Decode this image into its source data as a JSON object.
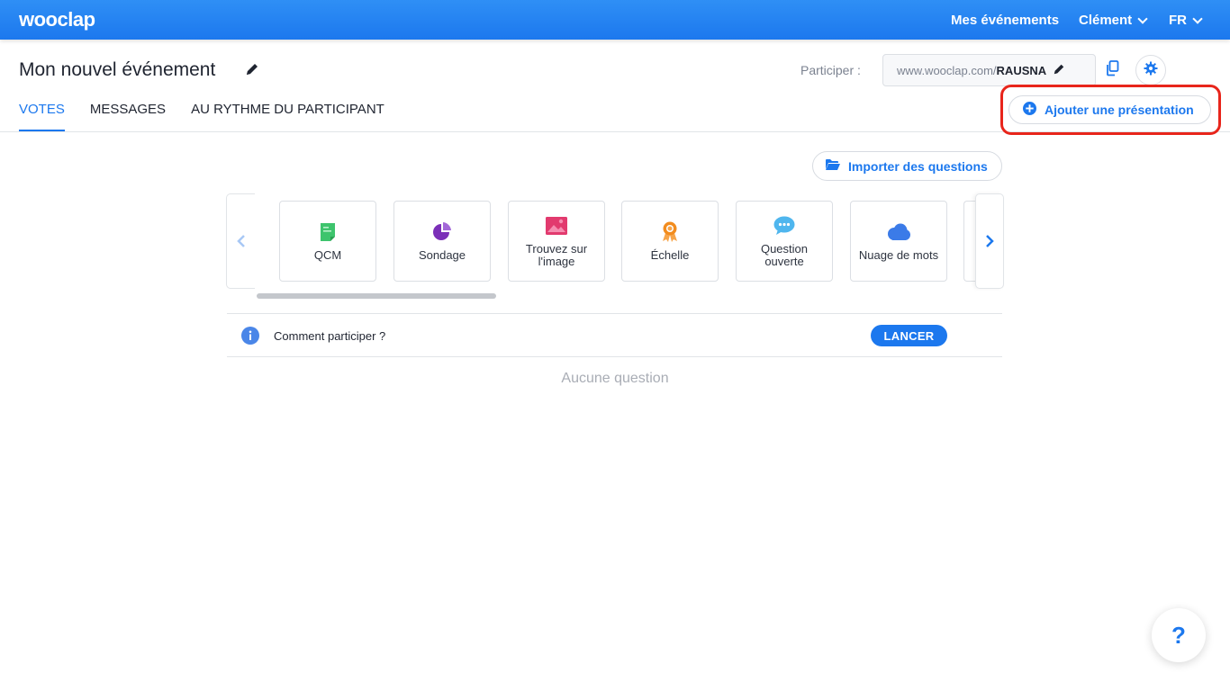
{
  "topbar": {
    "logo": "wooclap",
    "my_events": "Mes événements",
    "user": "Clément",
    "language": "FR"
  },
  "event": {
    "title": "Mon nouvel événement",
    "participate_label": "Participer :",
    "url_prefix": "www.wooclap.com/",
    "url_code": "RAUSNA"
  },
  "tabs": [
    {
      "label": "VOTES",
      "active": true
    },
    {
      "label": "MESSAGES",
      "active": false
    },
    {
      "label": "AU RYTHME DU PARTICIPANT",
      "active": false
    }
  ],
  "add_presentation_label": "Ajouter une présentation",
  "import_label": "Importer des questions",
  "question_types": [
    {
      "label": "QCM",
      "icon": "qcm-icon"
    },
    {
      "label": "Sondage",
      "icon": "pie-chart-icon"
    },
    {
      "label": "Trouvez sur l'image",
      "icon": "image-icon"
    },
    {
      "label": "Échelle",
      "icon": "ribbon-icon"
    },
    {
      "label": "Question ouverte",
      "icon": "speech-bubble-icon"
    },
    {
      "label": "Nuage de mots",
      "icon": "cloud-icon"
    }
  ],
  "participate_row": {
    "text": "Comment participer ?",
    "launch_label": "LANCER"
  },
  "empty_state": "Aucune question",
  "help_label": "?",
  "colors": {
    "brand": "#1c78ee",
    "highlight": "#e8251b"
  }
}
